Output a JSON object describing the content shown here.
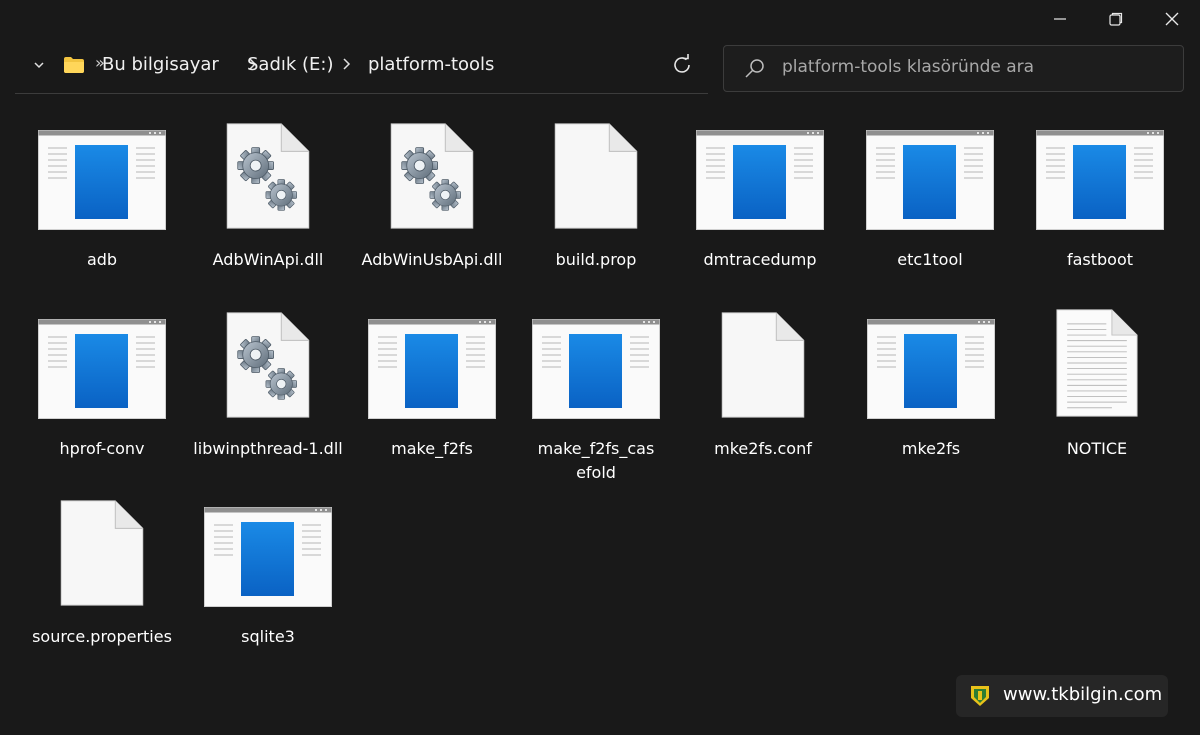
{
  "window": {
    "controls": [
      "minimize-icon",
      "restore-icon",
      "close-icon"
    ]
  },
  "address_bar": {
    "overflow_symbol": "»",
    "breadcrumbs": [
      "Bu bilgisayar",
      "Sadık (E:)",
      "platform-tools"
    ]
  },
  "search": {
    "placeholder": "platform-tools klasöründe ara"
  },
  "items": [
    {
      "name": "adb",
      "icon": "app-window-icon"
    },
    {
      "name": "AdbWinApi.dll",
      "icon": "dll-gears-icon"
    },
    {
      "name": "AdbWinUsbApi.dll",
      "icon": "dll-gears-icon"
    },
    {
      "name": "build.prop",
      "icon": "blank-file-icon"
    },
    {
      "name": "dmtracedump",
      "icon": "app-window-icon"
    },
    {
      "name": "etc1tool",
      "icon": "app-window-icon"
    },
    {
      "name": "fastboot",
      "icon": "app-window-icon"
    },
    {
      "name": "hprof-conv",
      "icon": "app-window-icon"
    },
    {
      "name": "libwinpthread-1.dll",
      "icon": "dll-gears-icon"
    },
    {
      "name": "make_f2fs",
      "icon": "app-window-icon"
    },
    {
      "name": "make_f2fs_casefold",
      "icon": "app-window-icon"
    },
    {
      "name": "mke2fs.conf",
      "icon": "blank-file-icon"
    },
    {
      "name": "mke2fs",
      "icon": "app-window-icon"
    },
    {
      "name": "NOTICE",
      "icon": "text-file-icon"
    },
    {
      "name": "source.properties",
      "icon": "blank-file-icon"
    },
    {
      "name": "sqlite3",
      "icon": "app-window-icon"
    }
  ],
  "watermark": {
    "text": "www.tkbilgin.com"
  }
}
